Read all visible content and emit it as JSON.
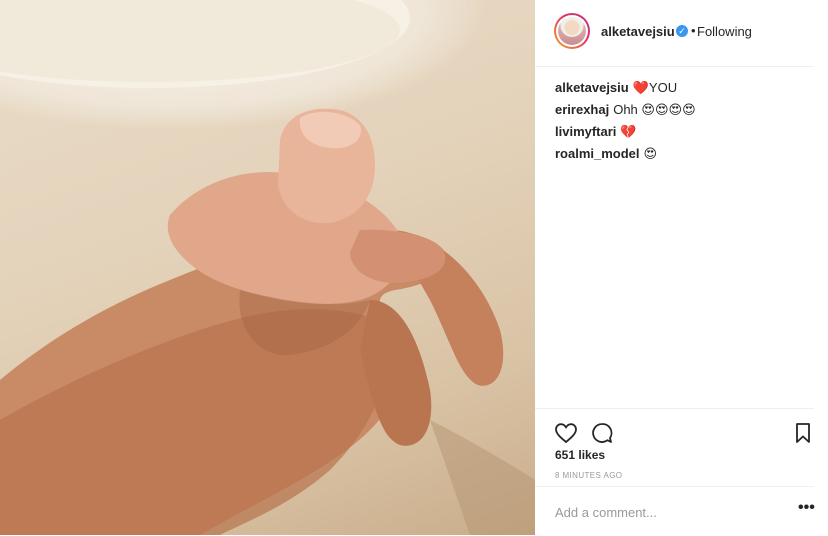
{
  "post": {
    "image_alt": "",
    "author": {
      "username": "alketavejsiu",
      "verified_icon": "verified-badge-icon",
      "separator": "•",
      "follow_status": "Following"
    },
    "comments": [
      {
        "username": "alketavejsiu",
        "text": "YOU",
        "emoji": "❤️"
      },
      {
        "username": "erirexhaj",
        "text": "Ohh",
        "emoji": "😍😍😍😍"
      },
      {
        "username": "livimyftari",
        "text": "",
        "emoji": "💔"
      },
      {
        "username": "roalmi_model",
        "text": "",
        "emoji": "😍"
      }
    ],
    "likes": "651 likes",
    "timestamp": "8 MINUTES AGO",
    "add_comment_placeholder": "Add a comment...",
    "more_label": "•••"
  },
  "colors": {
    "verified": "#3897f0",
    "text": "#262626",
    "muted": "#999999",
    "divider": "#efefef"
  }
}
